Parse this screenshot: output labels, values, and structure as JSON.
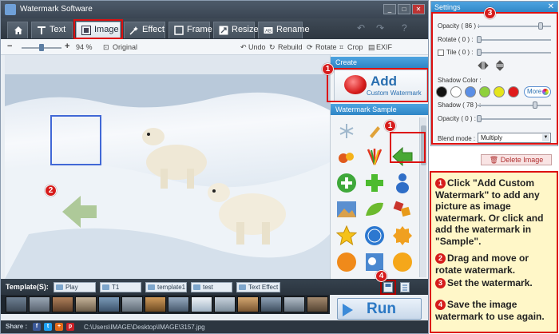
{
  "window": {
    "title": "Watermark Software",
    "min": "_",
    "max": "□",
    "close": "✕"
  },
  "tabs": [
    {
      "label": "Text",
      "icon": "text-icon"
    },
    {
      "label": "Image",
      "icon": "image-icon"
    },
    {
      "label": "Effect",
      "icon": "effect-icon"
    },
    {
      "label": "Frame",
      "icon": "frame-icon"
    },
    {
      "label": "Resize",
      "icon": "resize-icon"
    },
    {
      "label": "Rename",
      "icon": "rename-icon"
    }
  ],
  "toolbar": {
    "zoom": "94 %",
    "original": "Original",
    "undo": "Undo",
    "rebuild": "Rebuild",
    "rotate": "Rotate",
    "crop": "Crop",
    "exif": "EXIF"
  },
  "create_panel": {
    "header": "Create",
    "add_big": "Add",
    "add_small": "Custom Watermark",
    "sample_header": "Watermark Sample"
  },
  "settings": {
    "title": "Settings",
    "close": "✕",
    "opacity_label": "Opacity ( 86 ) :",
    "opacity_value": 0.86,
    "rotate_label": "Rotate ( 0 ) :",
    "tile_label": "Tile ( 0 ) :",
    "shadow_color_label": "Shadow Color :",
    "more_label": "More",
    "shadow_label": "Shadow ( 78 ) :",
    "shadow_value": 0.78,
    "shadow_opacity_label": "Opacity ( 0 ) :",
    "blend_label": "Blend mode :",
    "blend_value": "Multiply",
    "colors": [
      "#111111",
      "#ffffff",
      "#5b8fe6",
      "#8fd13c",
      "#e5e51b",
      "#e01b1b"
    ]
  },
  "delete_button": "Delete Image",
  "templates": {
    "label": "Template(S):",
    "items": [
      "Play",
      "T1",
      "template1",
      "test",
      "Text Effect ..."
    ]
  },
  "run_button": "Run",
  "status": {
    "share_label": "Share :",
    "path": "C:\\Users\\IMAGE\\Desktop\\IMAGE\\3157.jpg"
  },
  "badges": [
    "1",
    "1",
    "2",
    "3",
    "4"
  ],
  "instructions": [
    {
      "num": "1",
      "text": "Click \"Add Custom Watermark\" to add any picture as image watermark. Or click and add the watermark in \"Sample\"."
    },
    {
      "num": "2",
      "text": "Drag and move or rotate watermark."
    },
    {
      "num": "3",
      "text": "Set the watermark."
    },
    {
      "num": "4",
      "text": "Save the image watermark to use again."
    }
  ]
}
